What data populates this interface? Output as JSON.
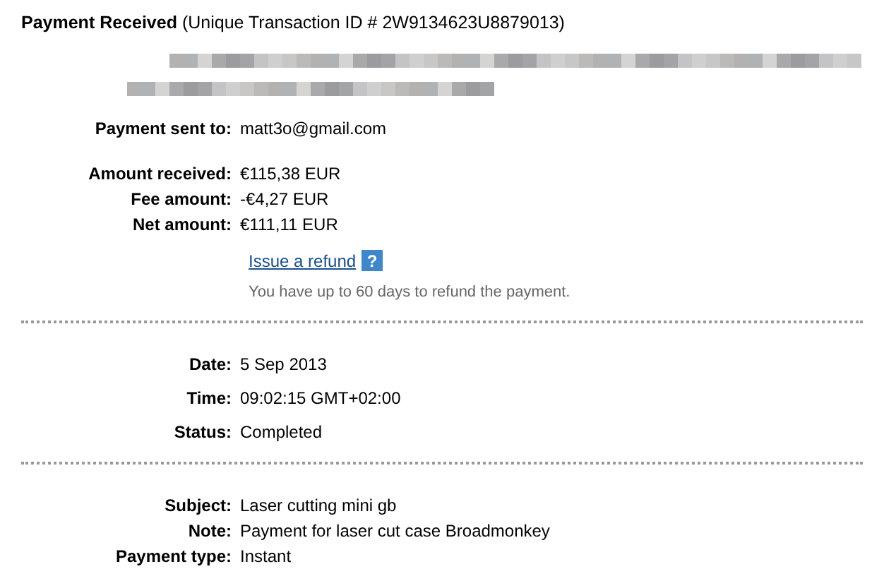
{
  "header": {
    "title": "Payment Received",
    "subtitle": "(Unique Transaction ID # 2W9134623U8879013)"
  },
  "sections": [
    {
      "groups": [
        [
          {
            "label": "Payment sent to:",
            "value": "matt3o@gmail.com"
          }
        ],
        [
          {
            "label": "Amount received:",
            "value": "€115,38 EUR"
          },
          {
            "label": "Fee amount:",
            "value": "-€4,27 EUR"
          },
          {
            "label": "Net amount:",
            "value": "€111,11 EUR"
          }
        ]
      ],
      "refund": {
        "link": "Issue a refund",
        "help": "?",
        "note": "You have up to 60 days to refund the payment."
      }
    },
    {
      "groups": [
        [
          {
            "label": "Date:",
            "value": "5 Sep 2013"
          },
          {
            "label": "Time:",
            "value": "09:02:15 GMT+02:00"
          },
          {
            "label": "Status:",
            "value": "Completed"
          }
        ]
      ]
    },
    {
      "groups": [
        [
          {
            "label": "Subject:",
            "value": "Laser cutting mini gb"
          },
          {
            "label": "Note:",
            "value": "Payment for laser cut case Broadmonkey"
          },
          {
            "label": "Payment type:",
            "value": "Instant"
          }
        ]
      ]
    }
  ]
}
